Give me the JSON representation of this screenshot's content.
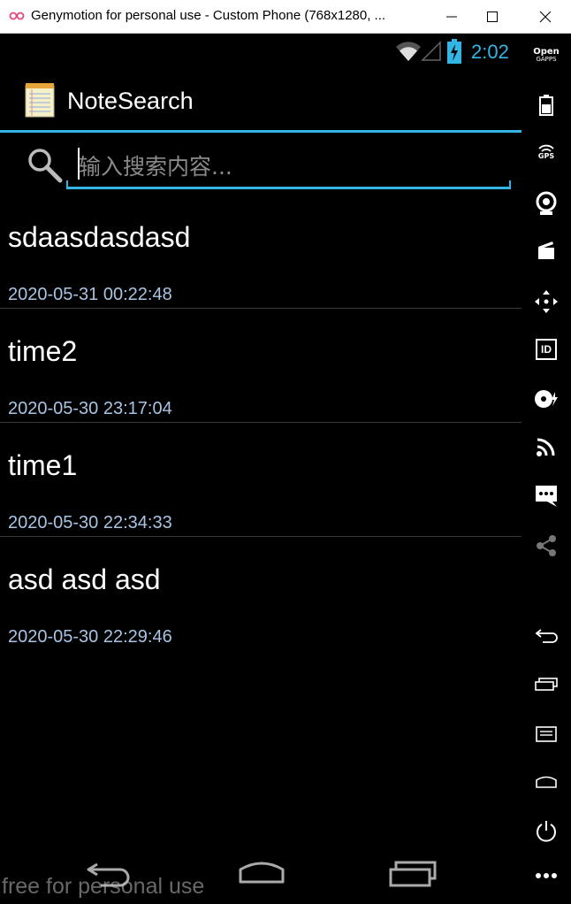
{
  "window": {
    "title": "Genymotion for personal use - Custom Phone (768x1280, ..."
  },
  "statusbar": {
    "time": "2:02",
    "accent": "#33b5e5"
  },
  "app": {
    "title": "NoteSearch"
  },
  "search": {
    "placeholder": "输入搜索内容...",
    "value": ""
  },
  "notes": [
    {
      "title": "sdaasdasdasd",
      "date": "2020-05-31 00:22:48"
    },
    {
      "title": "time2",
      "date": "2020-05-30 23:17:04"
    },
    {
      "title": "time1",
      "date": "2020-05-30 22:34:33"
    },
    {
      "title": "asd asd asd",
      "date": "2020-05-30 22:29:46"
    }
  ],
  "toolbar": {
    "open_gapps_line1": "Open",
    "open_gapps_line2": "GAPPS",
    "gps_label": "GPS",
    "id_label": "ID",
    "icons": [
      "open-gapps-icon",
      "battery-icon",
      "gps-icon",
      "webcam-icon",
      "media-icon",
      "dpad-icon",
      "identifiers-icon",
      "disk-io-icon",
      "cast-icon",
      "sms-icon",
      "share-icon",
      "back-icon",
      "recent-apps-icon",
      "menu-icon",
      "home-icon",
      "power-icon",
      "more-icon"
    ]
  },
  "watermark": "free for personal use"
}
